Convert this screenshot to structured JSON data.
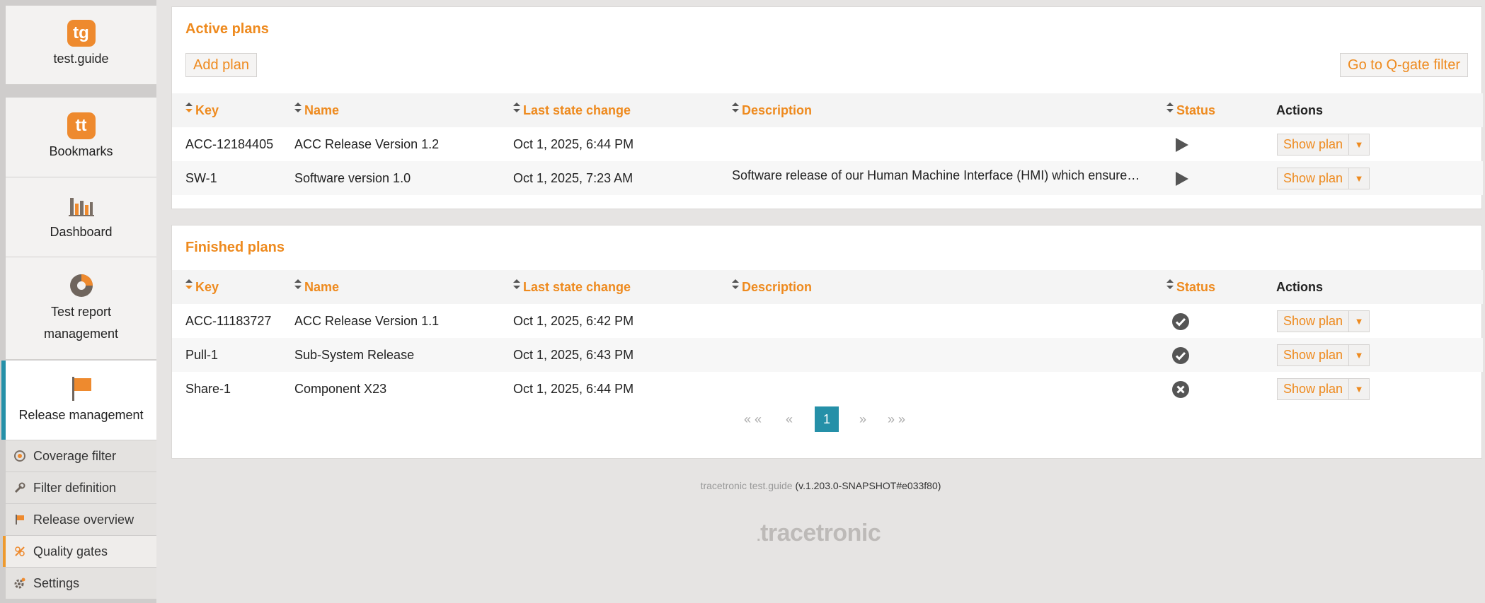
{
  "sidebar": {
    "app": {
      "logo": "tg",
      "label": "test.guide"
    },
    "nav": [
      {
        "label": "Bookmarks",
        "icon": "bookmark-logo-icon",
        "logo": "tt"
      },
      {
        "label": "Dashboard",
        "icon": "bar-chart-icon"
      },
      {
        "label": "Test report management",
        "icon": "pie-chart-icon"
      },
      {
        "label": "Release management",
        "icon": "flag-icon",
        "active": true
      }
    ],
    "sub": [
      {
        "label": "Coverage filter",
        "icon": "coverage-icon"
      },
      {
        "label": "Filter definition",
        "icon": "wrench-icon"
      },
      {
        "label": "Release overview",
        "icon": "flag-icon"
      },
      {
        "label": "Quality gates",
        "icon": "quality-gate-icon",
        "active": true
      },
      {
        "label": "Settings",
        "icon": "gear-icon"
      }
    ]
  },
  "columns": {
    "key": "Key",
    "name": "Name",
    "date": "Last state change",
    "desc": "Description",
    "status": "Status",
    "actions": "Actions"
  },
  "active": {
    "title": "Active plans",
    "add_label": "Add plan",
    "qgate_label": "Go to Q-gate filter",
    "rows": [
      {
        "key": "ACC-12184405",
        "name": "ACC Release Version 1.2",
        "date": "Oct 1, 2025, 6:44 PM",
        "desc": "",
        "status": "running",
        "action": "Show plan"
      },
      {
        "key": "SW-1",
        "name": "Software version 1.0",
        "date": "Oct 1, 2025, 7:23 AM",
        "desc": "Software release of our Human Machine Interface (HMI) which ensures t…",
        "status": "running",
        "action": "Show plan"
      }
    ]
  },
  "finished": {
    "title": "Finished plans",
    "rows": [
      {
        "key": "ACC-11183727",
        "name": "ACC Release Version 1.1",
        "date": "Oct 1, 2025, 6:42 PM",
        "desc": "",
        "status": "passed",
        "action": "Show plan"
      },
      {
        "key": "Pull-1",
        "name": "Sub-System Release",
        "date": "Oct 1, 2025, 6:43 PM",
        "desc": "",
        "status": "passed",
        "action": "Show plan"
      },
      {
        "key": "Share-1",
        "name": "Component X23",
        "date": "Oct 1, 2025, 6:44 PM",
        "desc": "",
        "status": "failed",
        "action": "Show plan"
      }
    ],
    "pagination": {
      "first": "« «",
      "prev": "«",
      "current": "1",
      "next": "»",
      "last": "» »"
    }
  },
  "footer": {
    "product": "tracetronic test.guide",
    "version": "(v.1.203.0-SNAPSHOT#e033f80)",
    "logo": "tracetronic"
  },
  "colors": {
    "accent": "#ee8a1e",
    "active": "#2590a8"
  }
}
